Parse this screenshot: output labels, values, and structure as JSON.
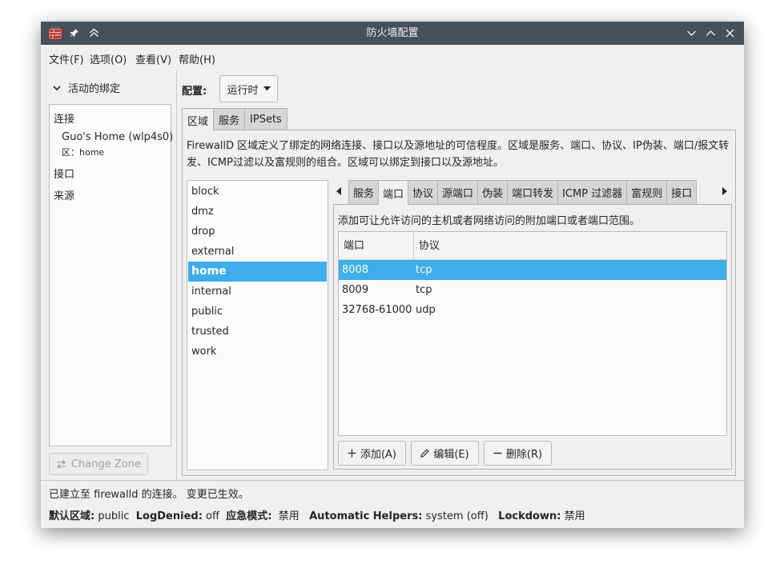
{
  "window": {
    "title": "防火墙配置"
  },
  "icons": {
    "app": "firewall-app-icon",
    "pin": "pin-icon",
    "keep_above": "double-chevron-up-icon",
    "minimize": "chevron-down-icon",
    "maximize": "chevron-up-icon",
    "close": "close-icon"
  },
  "menu": {
    "items": [
      "文件(F)",
      "选项(O)",
      "查看(V)",
      "帮助(H)"
    ]
  },
  "sidebar": {
    "heading": "活动的绑定",
    "sections": {
      "connections": "连接",
      "interfaces": "接口",
      "sources": "来源"
    },
    "connection": {
      "name": "Guo's Home (wlp4s0)",
      "zone": "区：home"
    },
    "change_zone_button": "Change Zone"
  },
  "config": {
    "label": "配置:",
    "value": "运行时"
  },
  "main_tabs": [
    "区域",
    "服务",
    "IPSets"
  ],
  "main_tabs_active": 0,
  "zone_description": "FirewallD 区域定义了绑定的网络连接、接口以及源地址的可信程度。区域是服务、端口、协议、IP伪装、端口/报文转发、ICMP过滤以及富规则的组合。区域可以绑定到接口以及源地址。",
  "zones": {
    "items": [
      "block",
      "dmz",
      "drop",
      "external",
      "home",
      "internal",
      "public",
      "trusted",
      "work"
    ],
    "selected": "home"
  },
  "sub_tabs": [
    "服务",
    "端口",
    "协议",
    "源端口",
    "伪装",
    "端口转发",
    "ICMP 过滤器",
    "富规则",
    "接口"
  ],
  "sub_tabs_active": 1,
  "ports_panel": {
    "description": "添加可让允许访问的主机或者网络访问的附加端口或者端口范围。",
    "columns": [
      "端口",
      "协议"
    ],
    "rows": [
      {
        "port": "8008",
        "protocol": "tcp",
        "selected": true
      },
      {
        "port": "8009",
        "protocol": "tcp",
        "selected": false
      },
      {
        "port": "32768-61000",
        "protocol": "udp",
        "selected": false
      }
    ],
    "buttons": {
      "add": "添加(A)",
      "edit": "编辑(E)",
      "remove": "删除(R)"
    }
  },
  "status": {
    "message": "已建立至 firewalld 的连接。 变更已生效。",
    "default_zone_label": "默认区域:",
    "default_zone_value": "public",
    "log_denied_label": "LogDenied:",
    "log_denied_value": "off",
    "panic_label": "应急模式:",
    "panic_value": "禁用",
    "helpers_label": "Automatic Helpers:",
    "helpers_value": "system (off)",
    "lockdown_label": "Lockdown:",
    "lockdown_value": "禁用"
  },
  "colors": {
    "selection": "#3daee9",
    "titlebar": "#475057",
    "window_bg": "#eff0f1"
  }
}
